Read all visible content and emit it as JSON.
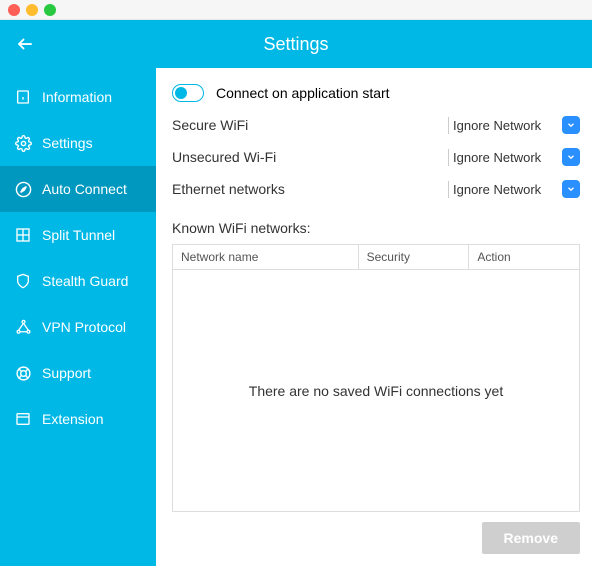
{
  "header": {
    "title": "Settings"
  },
  "sidebar": {
    "items": [
      {
        "label": "Information"
      },
      {
        "label": "Settings"
      },
      {
        "label": "Auto Connect"
      },
      {
        "label": "Split Tunnel"
      },
      {
        "label": "Stealth Guard"
      },
      {
        "label": "VPN Protocol"
      },
      {
        "label": "Support"
      },
      {
        "label": "Extension"
      }
    ]
  },
  "main": {
    "toggle_label": "Connect on application start",
    "options": [
      {
        "label": "Secure WiFi",
        "value": "Ignore Network"
      },
      {
        "label": "Unsecured Wi-Fi",
        "value": "Ignore Network"
      },
      {
        "label": "Ethernet networks",
        "value": "Ignore Network"
      }
    ],
    "known_label": "Known WiFi networks:",
    "columns": {
      "c1": "Network name",
      "c2": "Security",
      "c3": "Action"
    },
    "empty_msg": "There are no saved WiFi connections yet",
    "remove_label": "Remove"
  }
}
